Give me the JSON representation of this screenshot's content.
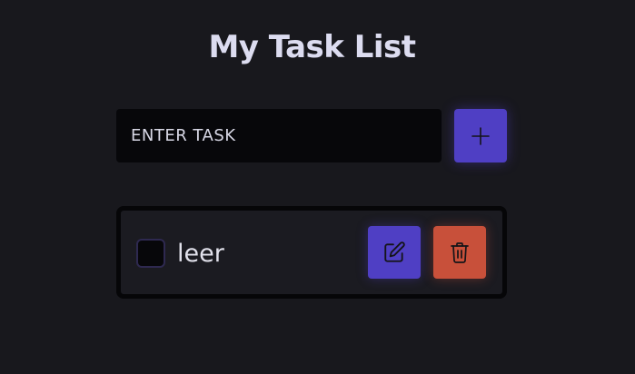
{
  "header": {
    "title": "My Task List"
  },
  "task_form": {
    "input_value": "",
    "input_placeholder": "ENTER TASK",
    "add_icon": "plus-icon"
  },
  "tasks": [
    {
      "text": "leer",
      "completed": false,
      "edit_icon": "pencil-icon",
      "delete_icon": "trash-icon"
    }
  ],
  "colors": {
    "background": "#18181d",
    "accent": "#4f3fc4",
    "danger": "#c8503a",
    "input_background": "#07070a",
    "card_border": "#060608"
  }
}
